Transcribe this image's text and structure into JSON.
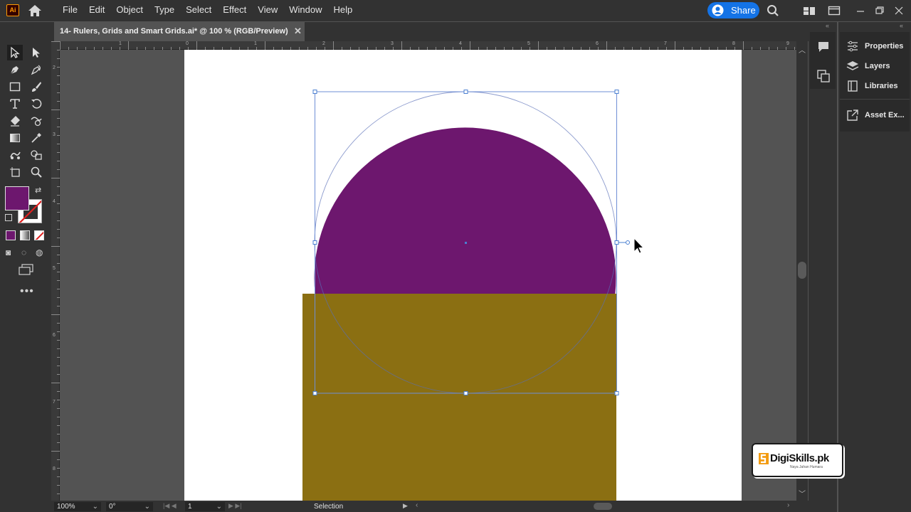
{
  "app": {
    "logo_text": "Ai",
    "menu": [
      "File",
      "Edit",
      "Object",
      "Type",
      "Select",
      "Effect",
      "View",
      "Window",
      "Help"
    ],
    "share_label": "Share"
  },
  "document": {
    "tab_title": "14- Rulers, Grids and Smart Grids.ai* @ 100 % (RGB/Preview)",
    "close_glyph": "✕"
  },
  "colors": {
    "fill": "#6d176e",
    "rect_fill": "#8b6f12",
    "selection": "#4a7fd0",
    "accent": "#1473e6"
  },
  "ruler": {
    "h_ticks": [
      "1",
      "0",
      "1",
      "2",
      "3",
      "4",
      "5",
      "6",
      "7",
      "8",
      "9"
    ],
    "v_ticks": [
      "2",
      "2",
      "3",
      "4",
      "5",
      "6",
      "7",
      "8"
    ]
  },
  "status": {
    "zoom": "100%",
    "rotation": "0°",
    "artboard": "1",
    "tool": "Selection"
  },
  "panels": {
    "items": [
      "Properties",
      "Layers",
      "Libraries",
      "Asset Ex..."
    ]
  },
  "watermark": {
    "text": "DigiSkills.pk",
    "tagline": "Naya Jahan Humara"
  },
  "tools": [
    "selection-tool",
    "direct-selection-tool",
    "pen-tool",
    "curvature-tool",
    "rectangle-tool",
    "paintbrush-tool",
    "type-tool",
    "rotate-tool",
    "eraser-tool",
    "warp-tool",
    "gradient-tool",
    "eyedropper-tool",
    "puppet-warp-tool",
    "shape-builder-tool",
    "artboard-tool",
    "zoom-tool"
  ]
}
